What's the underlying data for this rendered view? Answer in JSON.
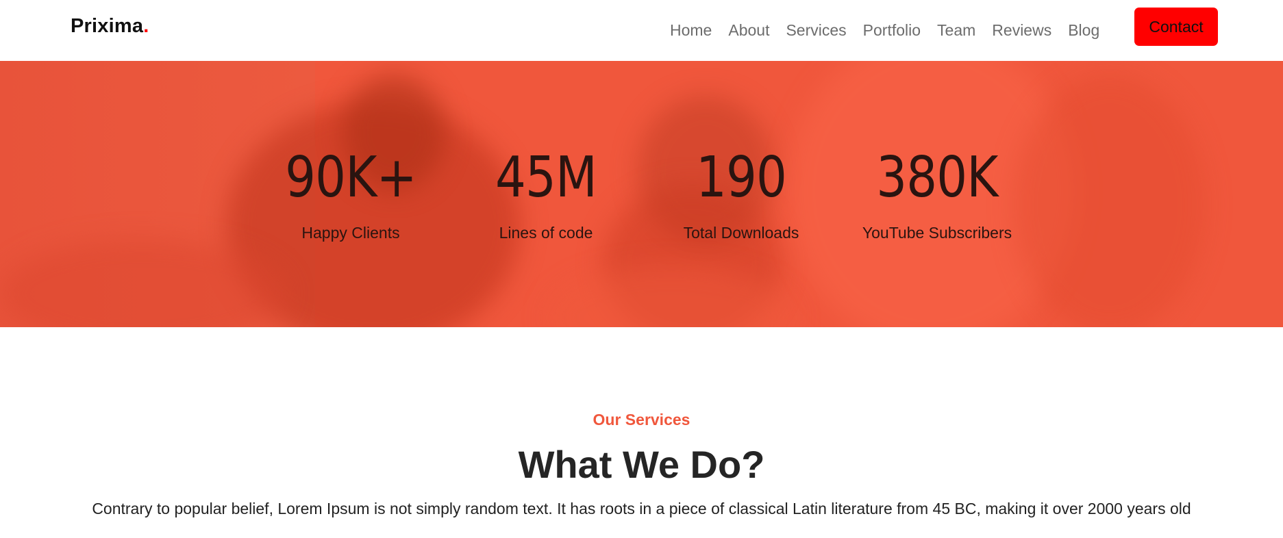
{
  "navbar": {
    "brand": "Prixima",
    "brand_dot": ".",
    "links": [
      "Home",
      "About",
      "Services",
      "Portfolio",
      "Team",
      "Reviews",
      "Blog"
    ],
    "contact_label": "Contact",
    "accent_color": "#ff0000"
  },
  "stats": {
    "items": [
      {
        "value": "90K+",
        "label": "Happy Clients"
      },
      {
        "value": "45M",
        "label": "Lines of code"
      },
      {
        "value": "190",
        "label": "Total Downloads"
      },
      {
        "value": "380K",
        "label": "YouTube Subscribers"
      }
    ],
    "overlay_color": "#f0573c"
  },
  "services": {
    "eyebrow": "Our Services",
    "title": "What We Do?",
    "description": "Contrary to popular belief, Lorem Ipsum is not simply random text. It has roots in a piece of classical Latin literature from 45 BC, making it over 2000 years old"
  }
}
